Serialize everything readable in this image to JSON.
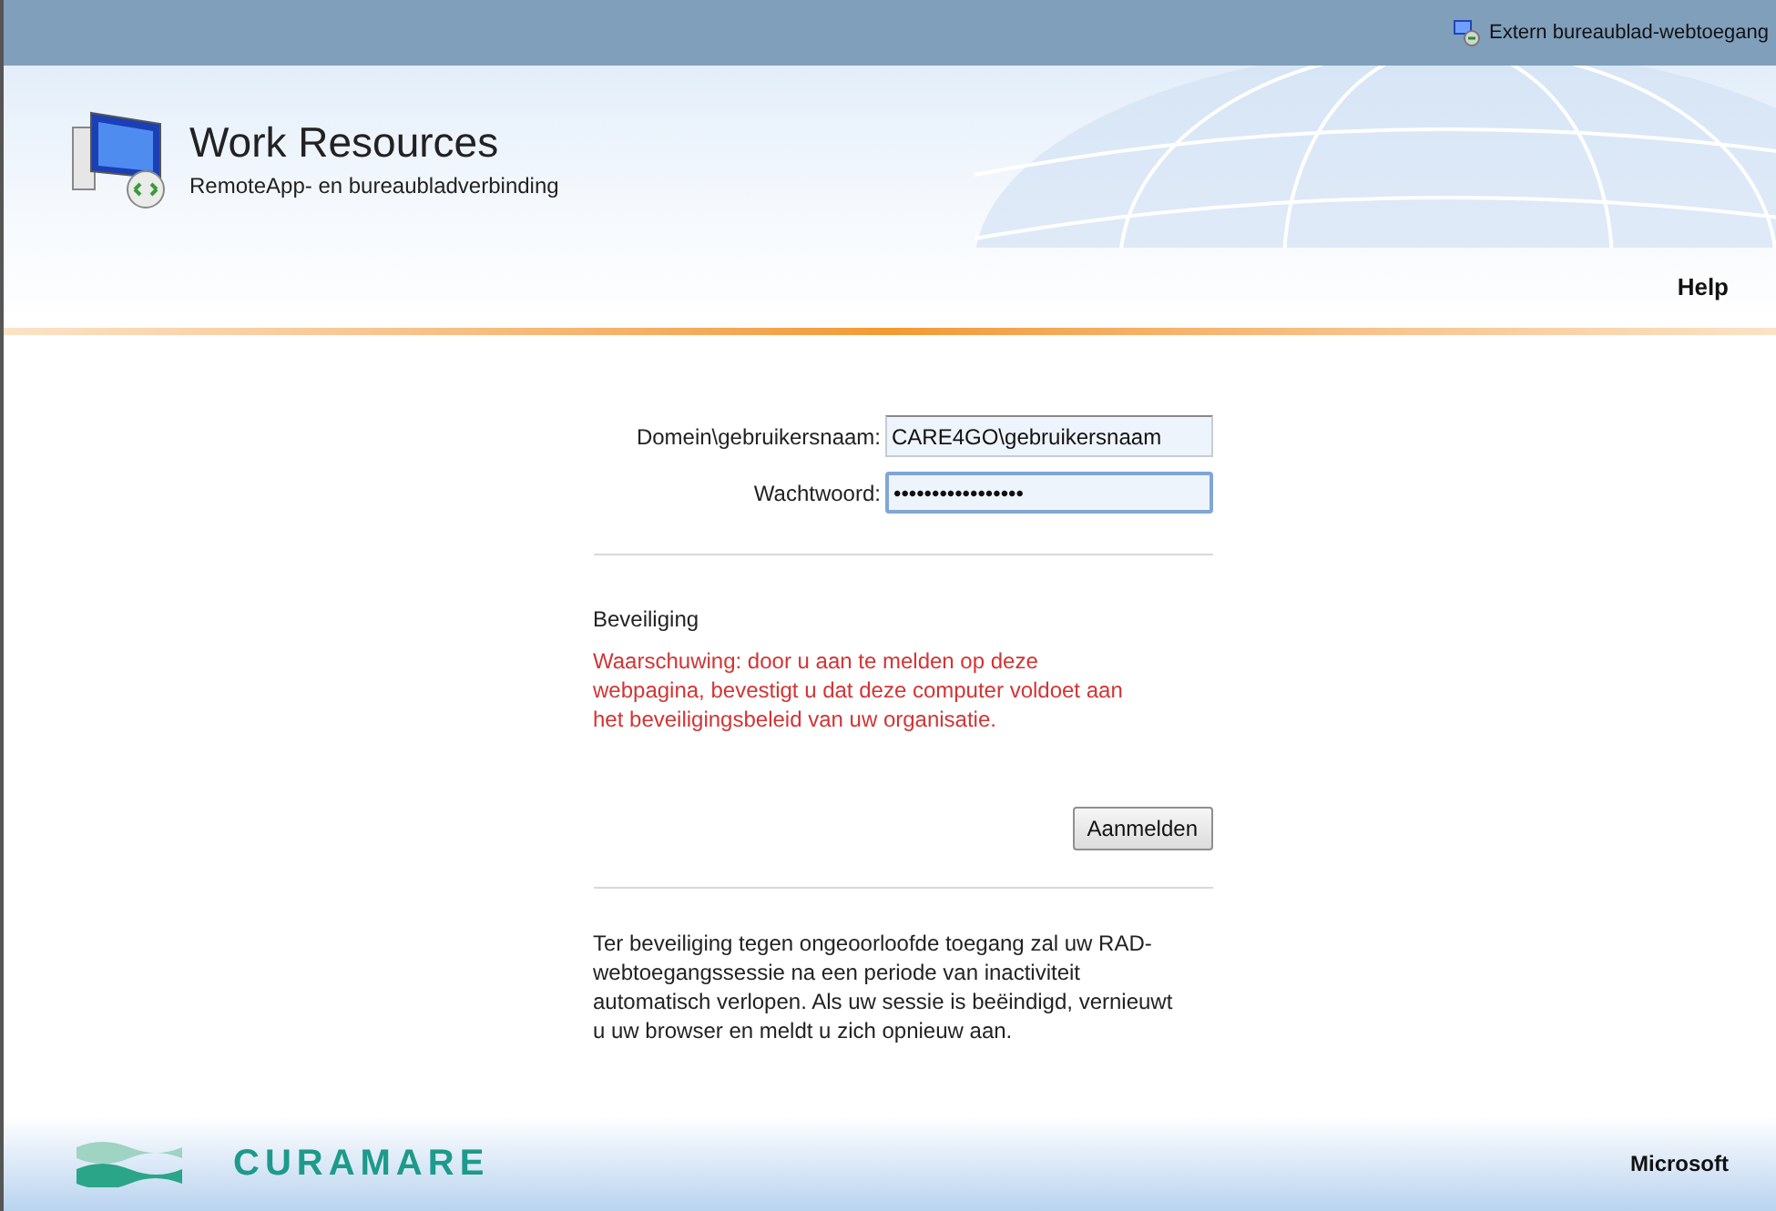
{
  "top_bar": {
    "link": "Extern bureaublad-webtoegang"
  },
  "header": {
    "title": "Work Resources",
    "subtitle": "RemoteApp- en bureaubladverbinding",
    "help": "Help"
  },
  "form": {
    "fields": [
      {
        "label": "Domein\\gebruikersnaam:",
        "value": "CARE4GO\\gebruikersnaam",
        "focused": false
      },
      {
        "label": "Wachtwoord:",
        "value": "•••••••••••••••••",
        "focused": true
      }
    ],
    "security_heading": "Beveiliging",
    "warning": "Waarschuwing: door u aan te melden op deze webpagina, bevestigt u dat deze computer voldoet aan het beveiligingsbeleid van uw organisatie.",
    "button": "Aanmelden",
    "note": "Ter beveiliging tegen ongeoorloofde toegang zal uw RAD-webtoegangssessie na een periode van inactiviteit automatisch verlopen. Als uw sessie is beëindigd, vernieuwt u uw browser en meldt u zich opnieuw aan."
  },
  "footer": {
    "brand": "CURAMARE",
    "vendor": "Microsoft"
  }
}
